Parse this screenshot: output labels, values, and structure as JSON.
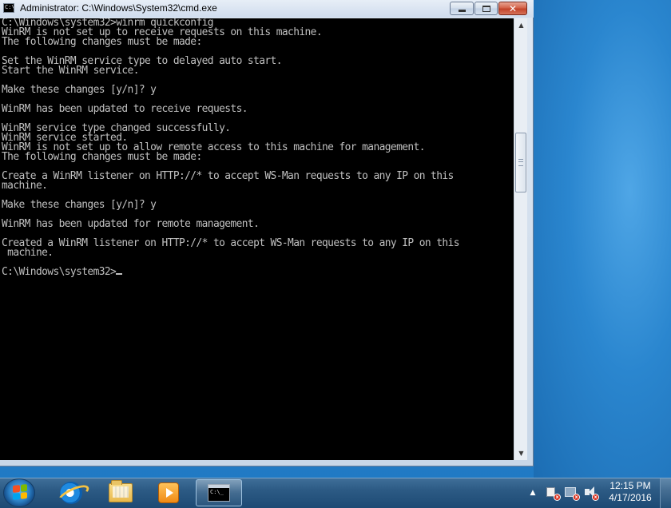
{
  "window": {
    "title": "Administrator: C:\\Windows\\System32\\cmd.exe",
    "icon": "cmd-icon",
    "close_label": "✕"
  },
  "console": {
    "lines": [
      "C:\\Windows\\system32>winrm quickconfig",
      "WinRM is not set up to receive requests on this machine.",
      "The following changes must be made:",
      "",
      "Set the WinRM service type to delayed auto start.",
      "Start the WinRM service.",
      "",
      "Make these changes [y/n]? y",
      "",
      "WinRM has been updated to receive requests.",
      "",
      "WinRM service type changed successfully.",
      "WinRM service started.",
      "WinRM is not set up to allow remote access to this machine for management.",
      "The following changes must be made:",
      "",
      "Create a WinRM listener on HTTP://* to accept WS-Man requests to any IP on this",
      "machine.",
      "",
      "Make these changes [y/n]? y",
      "",
      "WinRM has been updated for remote management.",
      "",
      "Created a WinRM listener on HTTP://* to accept WS-Man requests to any IP on this",
      " machine.",
      ""
    ],
    "prompt": "C:\\Windows\\system32>"
  },
  "taskbar": {
    "pinned": [
      {
        "name": "internet-explorer",
        "icon": "ie-icon"
      },
      {
        "name": "windows-explorer",
        "icon": "folder-icon"
      },
      {
        "name": "media-player",
        "icon": "media-player-icon"
      },
      {
        "name": "command-prompt",
        "icon": "cmd-icon",
        "active": true
      }
    ],
    "tray": {
      "icons": [
        "action-center-flag-icon",
        "network-icon",
        "volume-icon"
      ],
      "time": "12:15 PM",
      "date": "4/17/2016"
    }
  }
}
